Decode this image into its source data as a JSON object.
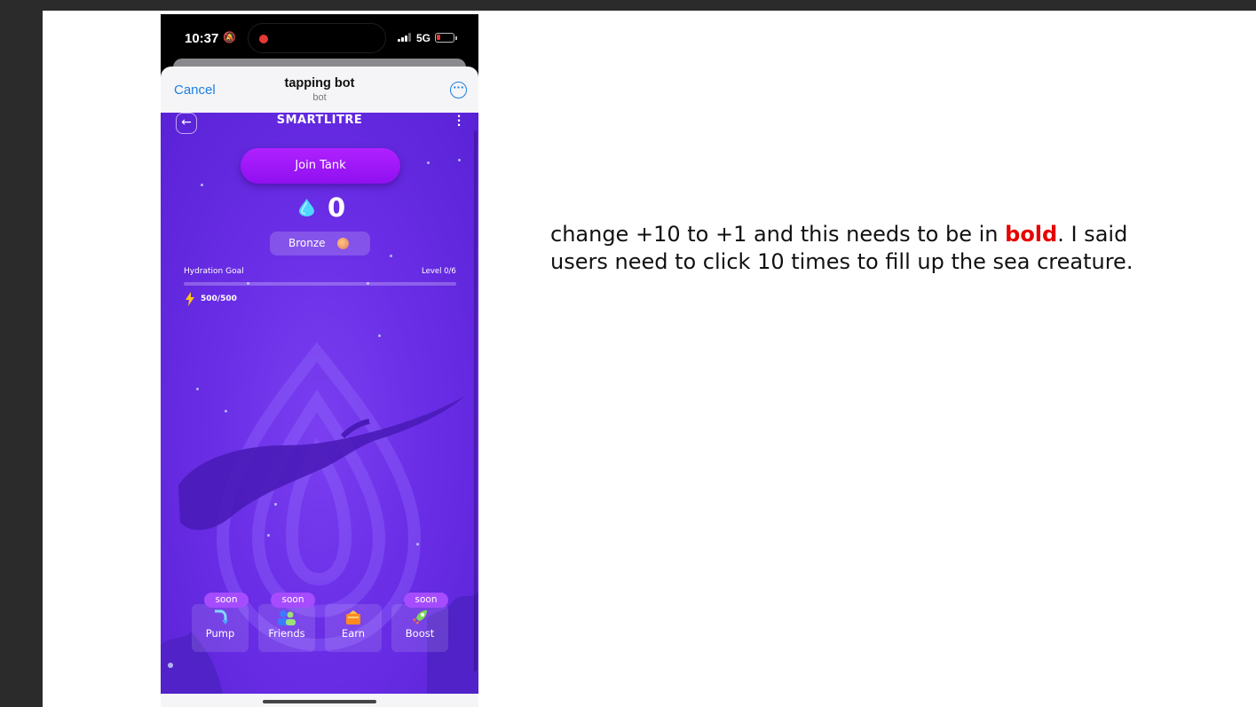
{
  "phone": {
    "status": {
      "time": "10:37",
      "network": "5G",
      "icon_bell": "bell-slash-icon"
    },
    "header": {
      "cancel_label": "Cancel",
      "title": "tapping bot",
      "subtitle": "bot",
      "more_icon": "ellipsis-circle-icon"
    },
    "game": {
      "brand": "SMARTLITRE",
      "join_label": "Join Tank",
      "score": "0",
      "rank": "Bronze",
      "goal_label": "Hydration Goal",
      "level_label": "Level 0/6",
      "goal_progress": 0,
      "energy": "500/500",
      "colors": {
        "background": "#6a2ee6",
        "join_button": "#a11cfb",
        "badge": "#a64cff"
      }
    },
    "nav": [
      {
        "label": "Pump",
        "badge": "soon",
        "icon": "pump-icon"
      },
      {
        "label": "Friends",
        "badge": "soon",
        "icon": "friends-icon"
      },
      {
        "label": "Earn",
        "badge": "",
        "icon": "earn-icon"
      },
      {
        "label": "Boost",
        "badge": "soon",
        "icon": "rocket-icon"
      }
    ]
  },
  "annotation": {
    "part1": "change +10 to +1 and this needs to be in ",
    "highlight": "bold",
    "part2": ". I said users need to click 10 times to fill up the sea creature.",
    "highlight_color": "#e60000"
  }
}
